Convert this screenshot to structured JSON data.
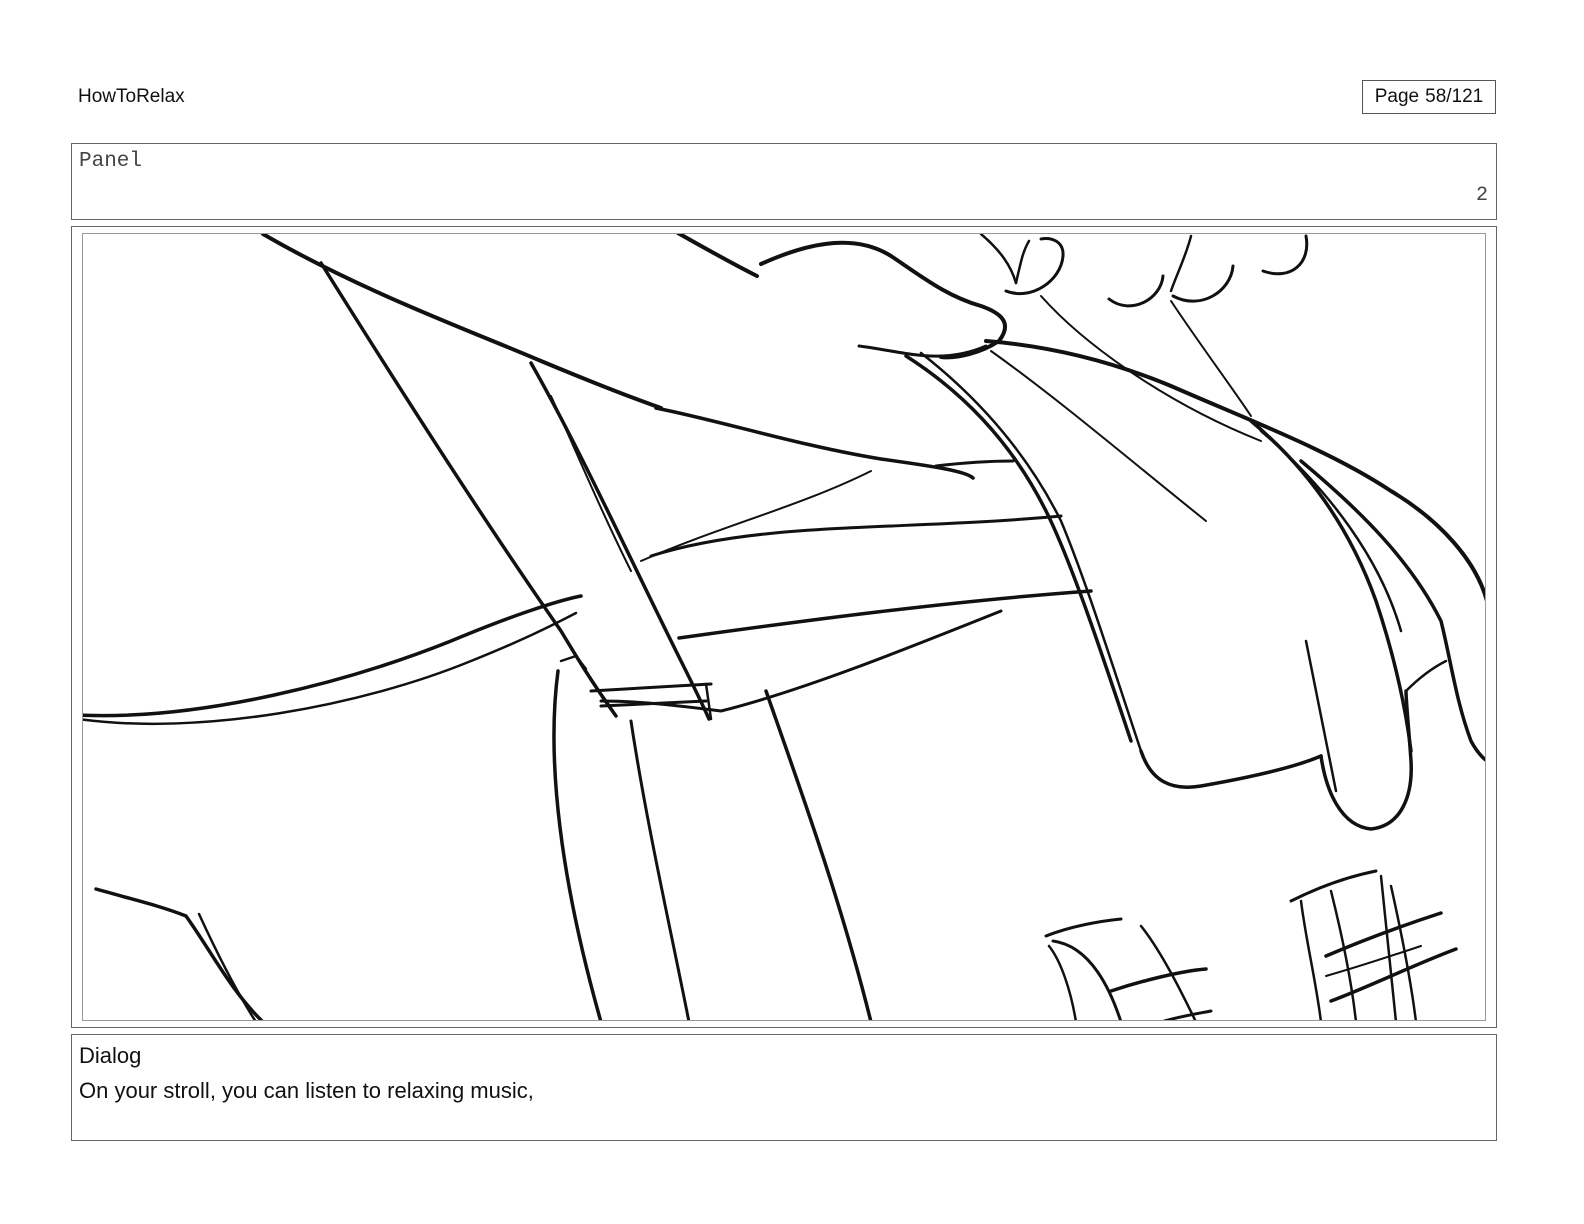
{
  "header": {
    "project_title": "HowToRelax",
    "page_word": "Page",
    "page_number": "58/121"
  },
  "panel": {
    "label": "Panel",
    "number": "2"
  },
  "dialog": {
    "label": "Dialog",
    "text": "On your stroll, you can listen to relaxing music,"
  }
}
